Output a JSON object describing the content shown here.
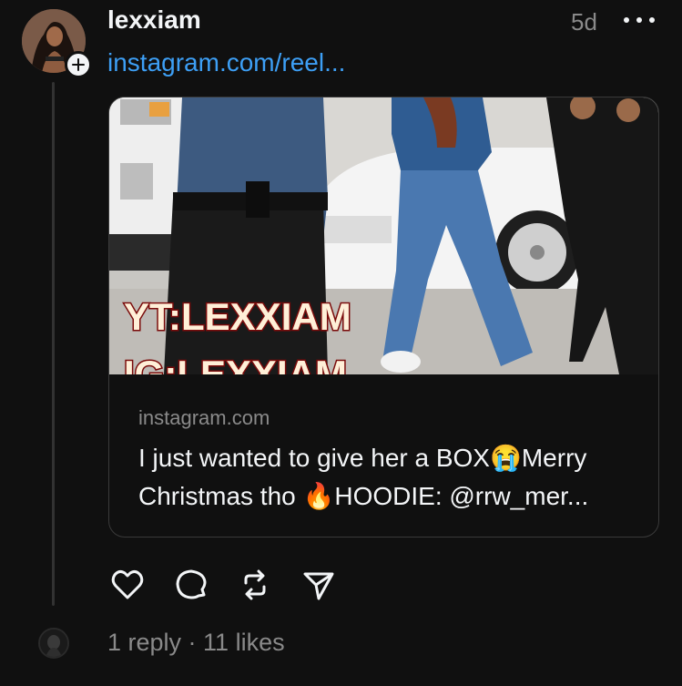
{
  "post": {
    "username": "lexxiam",
    "timestamp": "5d",
    "link_text": "instagram.com/reel...",
    "more_label": "More options"
  },
  "card": {
    "domain": "instagram.com",
    "title": "I just wanted to give her a BOX😭Merry Christmas tho 🔥HOODIE: @rrw_mer...",
    "overlay_line1": "YT:LEXXIAM",
    "overlay_line2": "IG:LEXXIAM"
  },
  "actions": {
    "like": "like-icon",
    "comment": "comment-icon",
    "repost": "repost-icon",
    "share": "share-icon"
  },
  "stats": {
    "replies": "1 reply",
    "separator": " · ",
    "likes": "11 likes"
  },
  "colors": {
    "background": "#101010",
    "text": "#f3f5f7",
    "muted": "#8a8a8a",
    "link": "#3d9ff5",
    "border": "#3a3a3a"
  }
}
